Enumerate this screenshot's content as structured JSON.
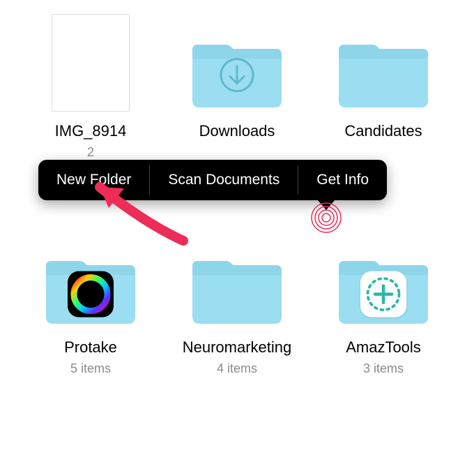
{
  "colors": {
    "folder": "#9bddf1",
    "folder_top": "#8fd5ea",
    "accent_red": "#ed2c57",
    "download_ring": "#5fb9d0"
  },
  "items": {
    "file1": {
      "name": "IMG_8914",
      "meta_partial": "2"
    },
    "downloads": {
      "name": "Downloads"
    },
    "candidates": {
      "name": "Candidates"
    },
    "protake": {
      "name": "Protake",
      "meta": "5 items"
    },
    "neuromarketing": {
      "name": "Neuromarketing",
      "meta": "4 items"
    },
    "amaztools": {
      "name": "AmazTools",
      "meta": "3 items"
    }
  },
  "context_menu": {
    "new_folder": "New Folder",
    "scan_documents": "Scan Documents",
    "get_info": "Get Info"
  }
}
